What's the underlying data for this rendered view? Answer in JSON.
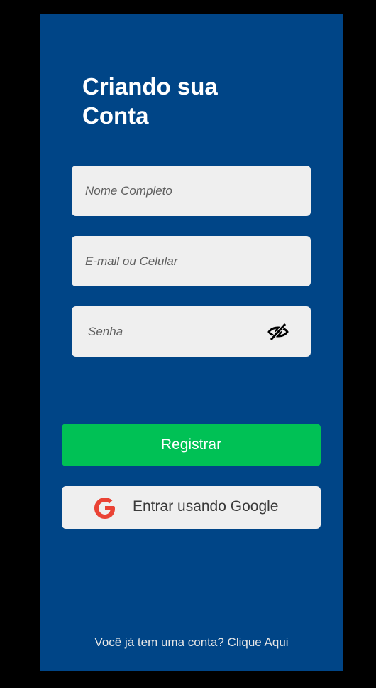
{
  "screen": {
    "title_line1": "Criando sua",
    "title_line2": "Conta"
  },
  "form": {
    "name_placeholder": "Nome Completo",
    "name_value": "",
    "contact_placeholder": "E-mail ou Celular",
    "contact_value": "",
    "password_placeholder": "Senha",
    "password_value": "",
    "password_toggle_icon": "eye-off-icon"
  },
  "actions": {
    "register_label": "Registrar",
    "google_label": "Entrar usando Google",
    "google_icon": "google-g-icon"
  },
  "footer": {
    "prompt": "Você já tem uma conta?",
    "link_label": "Clique Aqui"
  },
  "colors": {
    "background": "#000000",
    "screen": "#004587",
    "field": "#efefef",
    "register": "#00c155",
    "google_red": "#ea4335"
  }
}
